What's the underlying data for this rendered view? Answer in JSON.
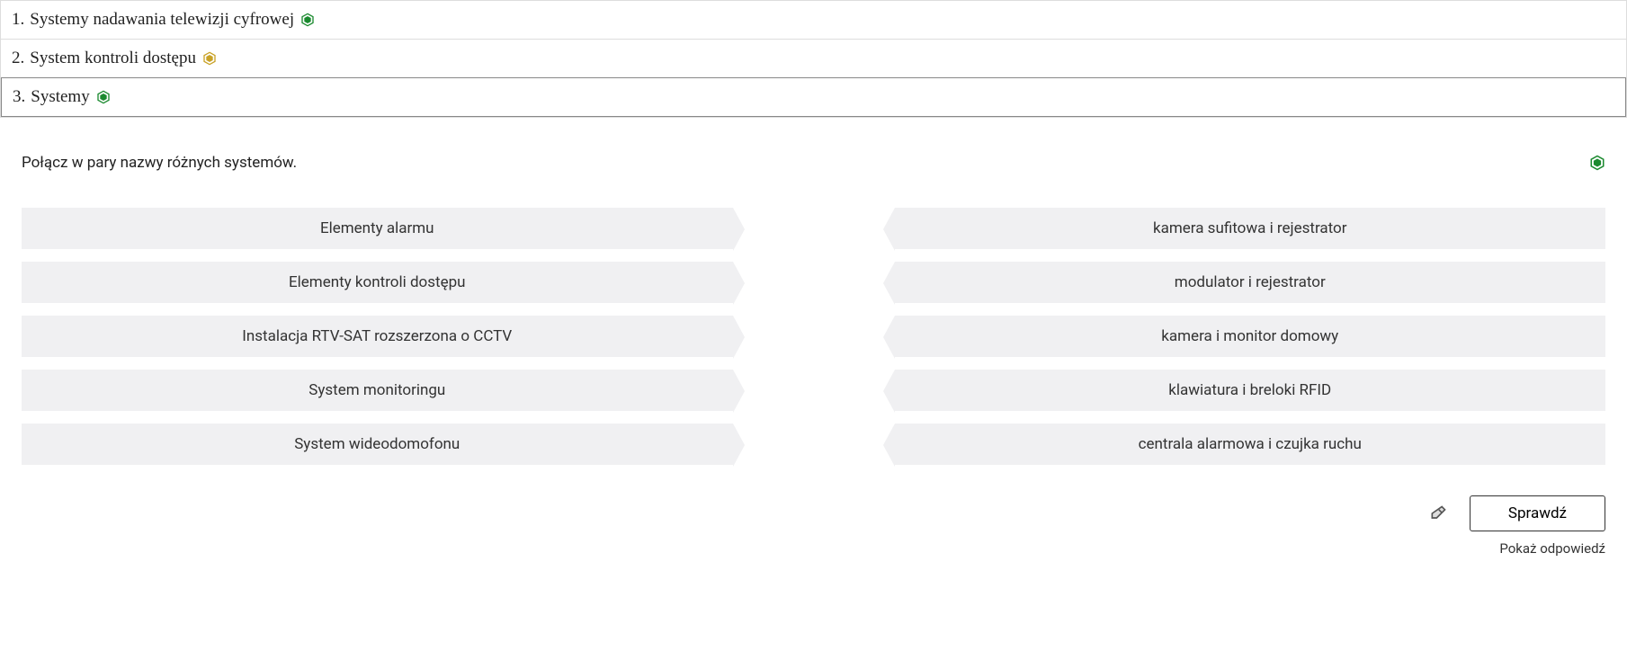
{
  "sections": [
    {
      "num": "1.",
      "title": "Systemy nadawania telewizji cyfrowej",
      "iconColor": "green"
    },
    {
      "num": "2.",
      "title": "System kontroli dostępu",
      "iconColor": "gold"
    },
    {
      "num": "3.",
      "title": "Systemy",
      "iconColor": "green"
    }
  ],
  "instruction": "Połącz w pary nazwy różnych systemów.",
  "leftItems": [
    "Elementy alarmu",
    "Elementy kontroli dostępu",
    "Instalacja RTV-SAT rozszerzona o CCTV",
    "System monitoringu",
    "System wideodomofonu"
  ],
  "rightItems": [
    "kamera sufitowa i rejestrator",
    "modulator i rejestrator",
    "kamera i monitor domowy",
    "klawiatura i breloki RFID",
    "centrala alarmowa i czujka ruchu"
  ],
  "checkLabel": "Sprawdź",
  "showAnswerLabel": "Pokaż odpowiedź"
}
